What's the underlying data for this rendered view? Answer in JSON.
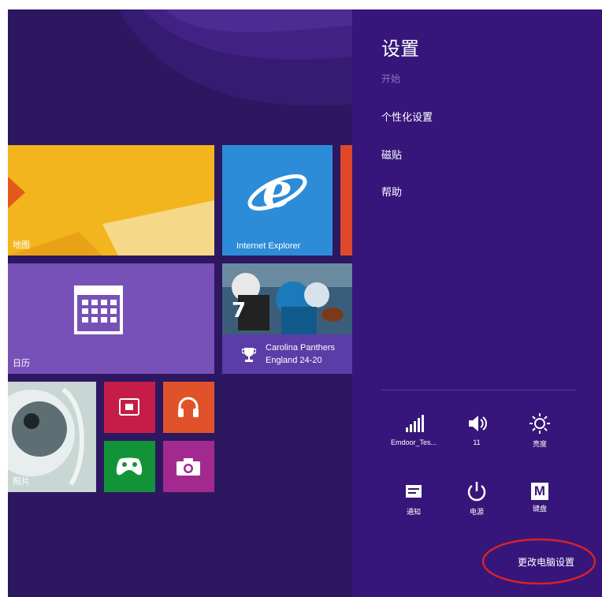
{
  "start_tiles": {
    "photo_tile_label": "地图",
    "calendar_tile_label": "日历",
    "ie_tile_label": "Internet Explorer",
    "sports_tile_line1": "Carolina Panthers",
    "sports_tile_line2": "England 24-20",
    "photos_tile_label": "照片"
  },
  "settings_charm": {
    "title": "设置",
    "subtitle": "开始",
    "items": [
      {
        "label": "个性化设置"
      },
      {
        "label": "磁贴"
      },
      {
        "label": "帮助"
      }
    ],
    "quick_settings": [
      {
        "icon": "wifi-signal-icon",
        "label": "Emdoor_Tes..."
      },
      {
        "icon": "volume-icon",
        "label": "11"
      },
      {
        "icon": "brightness-icon",
        "label": "亮度"
      },
      {
        "icon": "notifications-icon",
        "label": "通知"
      },
      {
        "icon": "power-icon",
        "label": "电源"
      },
      {
        "icon": "keyboard-icon",
        "label": "键盘"
      }
    ],
    "keyboard_glyph": "M",
    "change_pc_settings": "更改电脑设置",
    "highlight_color": "#d4222a"
  }
}
